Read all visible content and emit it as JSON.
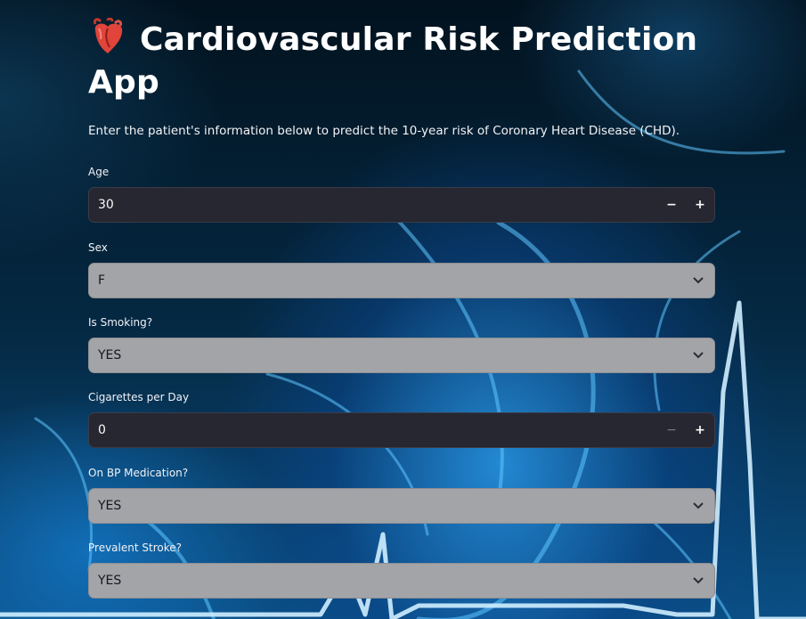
{
  "page": {
    "title_line1": "Cardiovascular Risk Prediction",
    "title_line2": "App",
    "title_icon": "anatomical-heart-icon",
    "description": "Enter the patient's information below to predict the 10-year risk of Coronary Heart Disease (CHD)."
  },
  "fields": {
    "age": {
      "label": "Age",
      "value": "30",
      "minus": "−",
      "plus": "+"
    },
    "sex": {
      "label": "Sex",
      "value": "F"
    },
    "is_smoking": {
      "label": "Is Smoking?",
      "value": "YES"
    },
    "cigs_per_day": {
      "label": "Cigarettes per Day",
      "value": "0",
      "minus": "−",
      "plus": "+"
    },
    "bp_meds": {
      "label": "On BP Medication?",
      "value": "YES"
    },
    "prevalent_stroke": {
      "label": "Prevalent Stroke?",
      "value": "YES"
    }
  },
  "colors": {
    "number_input_bg": "#262730",
    "select_bg": "#a3a4a8",
    "text": "#ffffff",
    "background_accent": "#1e8fe0"
  }
}
